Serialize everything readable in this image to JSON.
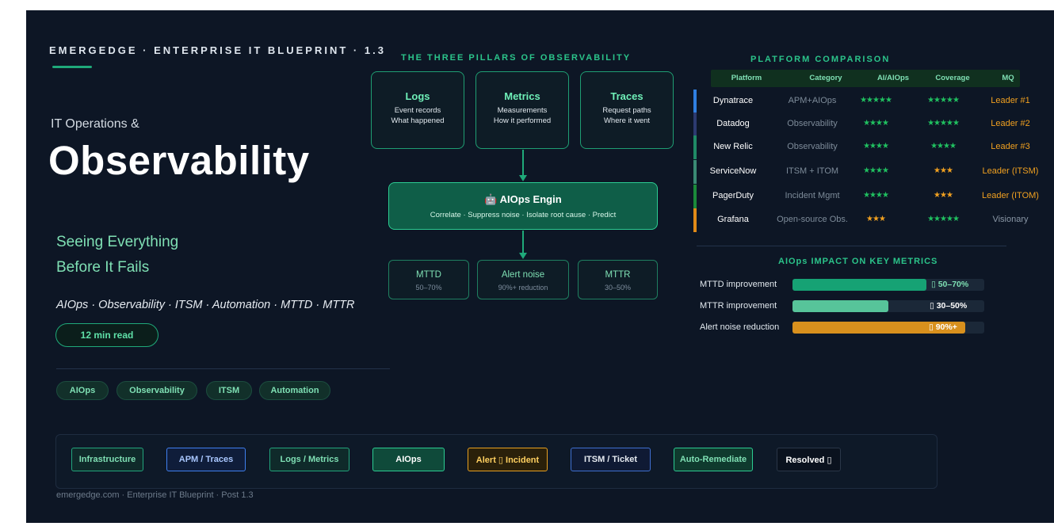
{
  "brand": "EMERGEDGE · ENTERPRISE IT BLUEPRINT · 1.3",
  "hero": {
    "subtitle": "IT Operations &",
    "title": "Observability",
    "tagline_line1": "Seeing Everything",
    "tagline_line2": "Before It Fails",
    "keywords": "AIOps · Observability · ITSM · Automation · MTTD · MTTR",
    "read_time": "12 min read"
  },
  "tags": [
    "AIOps",
    "Observability",
    "ITSM",
    "Automation"
  ],
  "pillars": {
    "title": "THE THREE PILLARS OF OBSERVABILITY",
    "items": [
      {
        "name": "Logs",
        "line1": "Event records",
        "line2": "What happened"
      },
      {
        "name": "Metrics",
        "line1": "Measurements",
        "line2": "How it performed"
      },
      {
        "name": "Traces",
        "line1": "Request paths",
        "line2": "Where it went"
      }
    ]
  },
  "engine": {
    "icon": "robot-icon",
    "title": "AIOps Engin",
    "subtitle": "Correlate · Suppress noise · Isolate root cause · Predict"
  },
  "outcomes": [
    {
      "name": "MTTD",
      "value": "50–70%"
    },
    {
      "name": "Alert noise",
      "value": "90%+ reduction"
    },
    {
      "name": "MTTR",
      "value": "30–50%"
    }
  ],
  "comparison": {
    "title": "PLATFORM COMPARISON",
    "headers": [
      "Platform",
      "Category",
      "AI/AIOps",
      "Coverage",
      "MQ"
    ],
    "rows": [
      {
        "platform": "Dynatrace",
        "category": "APM+AIOps",
        "ai": "★★★★★",
        "coverage": "★★★★★",
        "mq": "Leader #1",
        "bar": "#2f7fe0"
      },
      {
        "platform": "Datadog",
        "category": "Observability",
        "ai": "★★★★",
        "coverage": "★★★★★",
        "mq": "Leader #2",
        "bar": "#2c3a70"
      },
      {
        "platform": "New Relic",
        "category": "Observability",
        "ai": "★★★★",
        "coverage": "★★★★",
        "mq": "Leader #3",
        "bar": "#1f8a66"
      },
      {
        "platform": "ServiceNow",
        "category": "ITSM + ITOM",
        "ai": "★★★★",
        "coverage": "★★★",
        "mq": "Leader (ITSM)",
        "bar": "#3a8a74"
      },
      {
        "platform": "PagerDuty",
        "category": "Incident Mgmt",
        "ai": "★★★★",
        "coverage": "★★★",
        "mq": "Leader (ITOM)",
        "bar": "#1a8a3a"
      },
      {
        "platform": "Grafana",
        "category": "Open-source Obs.",
        "ai": "★★★",
        "coverage": "★★★★★",
        "mq": "Visionary",
        "bar": "#e08a18"
      }
    ]
  },
  "impact": {
    "title": "AIOps IMPACT ON KEY METRICS",
    "items": [
      {
        "label": "MTTD improvement",
        "text": "▯ 50–70%",
        "fill": 0.7,
        "color": "#16a274",
        "text_color": "#7fe0b4"
      },
      {
        "label": "MTTR improvement",
        "text": "▯ 30–50%",
        "fill": 0.5,
        "color": "#57c49a",
        "text_color": "#ffffff"
      },
      {
        "label": "Alert noise reduction",
        "text": "▯ 90%+",
        "fill": 0.9,
        "color": "#d8901d",
        "text_color": "#ffffff"
      }
    ]
  },
  "flow": [
    {
      "label": "Infrastructure",
      "border": "#22a57c",
      "bg": "#0f2a2a",
      "color": "#7fe0b4"
    },
    {
      "label": "APM / Traces",
      "border": "#3f7ff0",
      "bg": "#0f1d3a",
      "color": "#a9c7ff"
    },
    {
      "label": "Logs / Metrics",
      "border": "#22a57c",
      "bg": "#0f2a2a",
      "color": "#7fe0b4"
    },
    {
      "label": "AIOps",
      "border": "#2ccc92",
      "bg": "#0f4a3a",
      "color": "#ffffff"
    },
    {
      "label": "Alert ▯ Incident",
      "border": "#e8a020",
      "bg": "#2a200a",
      "color": "#ffd060"
    },
    {
      "label": "ITSM / Ticket",
      "border": "#3f6fd0",
      "bg": "#0f1a34",
      "color": "#e6ebf1"
    },
    {
      "label": "Auto-Remediate",
      "border": "#2ccc92",
      "bg": "#0f3a2e",
      "color": "#7fe0b4"
    },
    {
      "label": "Resolved ▯",
      "border": "#2a3648",
      "bg": "#0a121e",
      "color": "#ffffff"
    }
  ],
  "footer": "emergedge.com · Enterprise IT Blueprint · Post 1.3"
}
